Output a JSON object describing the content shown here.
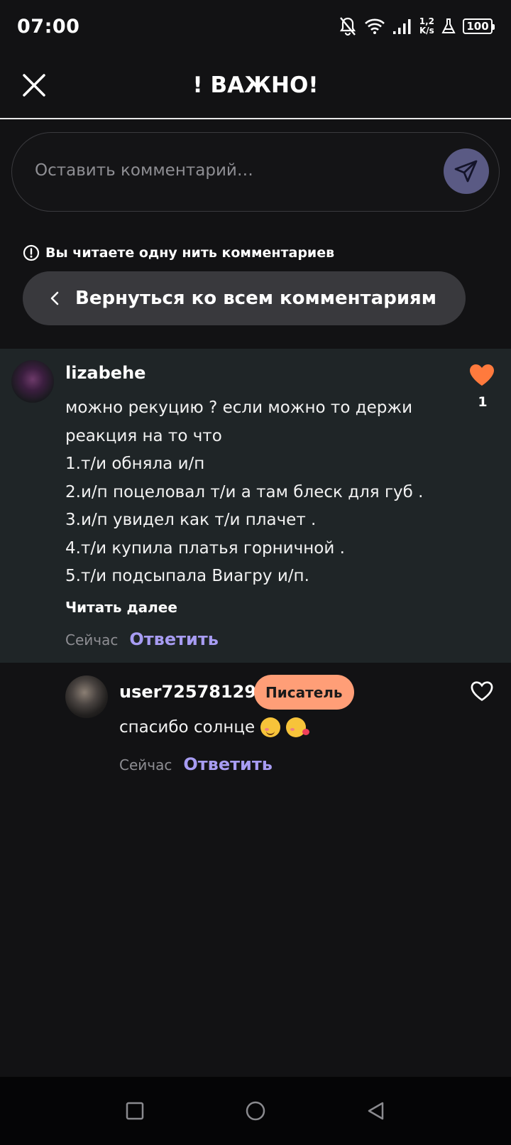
{
  "status_bar": {
    "time": "07:00",
    "net_speed_value": "1,2",
    "net_speed_unit": "K/s",
    "battery": "100",
    "icons": [
      "bell-off-icon",
      "wifi-icon",
      "signal-icon",
      "flask-icon",
      "battery-icon"
    ]
  },
  "header": {
    "title": "! ВАЖНО!",
    "close_icon": "close-icon"
  },
  "comment_input": {
    "placeholder": "Оставить комментарий…",
    "send_icon": "send-icon"
  },
  "thread": {
    "notice": "Вы читаете одну нить комментариев",
    "back_label": "Вернуться ко всем комментариям"
  },
  "comments": [
    {
      "username": "lizabehe",
      "lines": [
        "можно рекуцию ? если можно то держи",
        "реакция на то что",
        "1.т/и обняла и/п",
        "2.и/п поцеловал т/и а там блеск для губ .",
        "3.и/п увидел как т/и плачет .",
        "4.т/и купила платья горничной .",
        "5.т/и подсыпала Виагру и/п."
      ],
      "read_more": "Читать далее",
      "time": "Сейчас",
      "reply": "Ответить",
      "likes": "1",
      "liked": true
    },
    {
      "username": "user72578129",
      "badge": "Писатель",
      "text": "спасибо солнце",
      "emojis": [
        "smiling-blush-emoji",
        "kissing-face-emoji"
      ],
      "time": "Сейчас",
      "reply": "Ответить",
      "liked": false
    }
  ],
  "colors": {
    "background": "#121214",
    "highlight_bg": "#1f2527",
    "accent_link": "#a79cf2",
    "heart": "#ff7a3d",
    "badge_bg": "#ff9e77",
    "send_bg": "#5a5a84"
  }
}
